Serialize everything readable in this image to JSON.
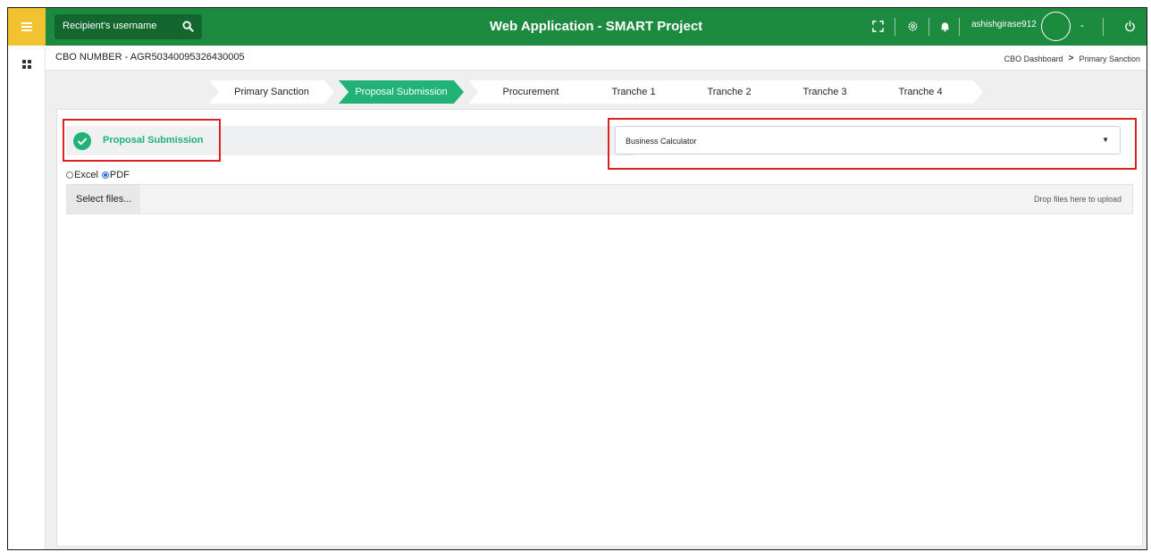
{
  "topbar": {
    "search_placeholder": "Recipient's username",
    "title": "Web Application - SMART Project",
    "username": "ashishgirase912",
    "caret": "-"
  },
  "crumbbar": {
    "cbo_number": "CBO NUMBER - AGR50340095326430005",
    "breadcrumb": [
      "CBO Dashboard",
      "Primary Sanction"
    ],
    "breadcrumb_sep": ">"
  },
  "steps": [
    {
      "label": "Primary Sanction",
      "active": false
    },
    {
      "label": "Proposal Submission",
      "active": true
    },
    {
      "label": "Procurement",
      "active": false
    },
    {
      "label": "Tranche 1",
      "active": false
    },
    {
      "label": "Tranche 2",
      "active": false
    },
    {
      "label": "Tranche 3",
      "active": false
    },
    {
      "label": "Tranche 4",
      "active": false
    }
  ],
  "status": {
    "label": "Proposal Submission"
  },
  "calculator": {
    "selected": "Business Calculator"
  },
  "format": {
    "options": [
      {
        "label": "Excel",
        "checked": false
      },
      {
        "label": "PDF",
        "checked": true
      }
    ]
  },
  "upload": {
    "button_label": "Select files...",
    "drop_text": "Drop files here to upload"
  },
  "colors": {
    "topbar": "#1c8a3f",
    "menu": "#f2c230",
    "accent": "#20b277",
    "highlight": "#e02020"
  }
}
